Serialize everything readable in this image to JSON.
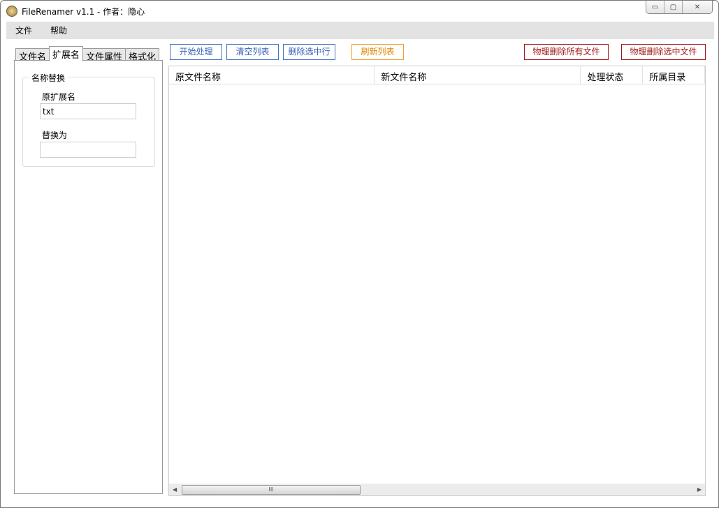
{
  "window": {
    "title": "FileRenamer v1.1 - 作者：隐心",
    "min": "▭",
    "max": "▢",
    "close": "✕"
  },
  "menu": [
    "文件",
    "帮助"
  ],
  "tabs": [
    "文件名",
    "扩展名",
    "文件属性",
    "格式化"
  ],
  "group": {
    "title": "名称替换",
    "original_label": "原扩展名",
    "original_value": "txt",
    "replace_label": "替换为",
    "replace_value": ""
  },
  "toolbar": {
    "start": "开始处理",
    "clear": "清空列表",
    "delete_rows": "删除选中行",
    "refresh": "刷新列表",
    "delete_all_files": "物理删除所有文件",
    "delete_selected_files": "物理删除选中文件"
  },
  "columns": [
    "原文件名称",
    "新文件名称",
    "处理状态",
    "所属目录"
  ],
  "scrollbar": {
    "left": "◀",
    "right": "▶",
    "grip": "III"
  },
  "colors": {
    "blue": "#3a62b4",
    "orange": "#e08400",
    "red": "#a01818"
  }
}
